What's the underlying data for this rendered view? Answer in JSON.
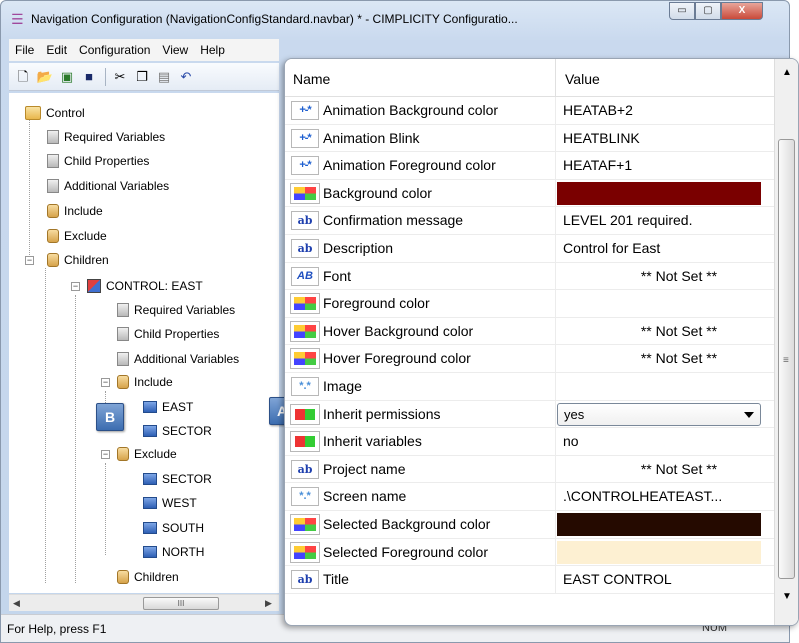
{
  "window": {
    "title": "Navigation Configuration (NavigationConfigStandard.navbar) * - CIMPLICITY Configuratio...",
    "minimize": "▭",
    "maximize": "▢",
    "close": "X"
  },
  "menu": [
    "File",
    "Edit",
    "Configuration",
    "View",
    "Help"
  ],
  "tree": {
    "nodes": [
      {
        "label": "Control",
        "icon": "folder-icon"
      },
      {
        "label": "Required Variables",
        "icon": "property-icon"
      },
      {
        "label": "Child Properties",
        "icon": "property-icon"
      },
      {
        "label": "Additional Variables",
        "icon": "property-icon"
      },
      {
        "label": "Include",
        "icon": "jar-icon"
      },
      {
        "label": "Exclude",
        "icon": "jar-icon"
      },
      {
        "label": "Children",
        "icon": "jar-icon"
      },
      {
        "label": "CONTROL: EAST",
        "icon": "control-icon"
      },
      {
        "label": "Required Variables",
        "icon": "property-icon"
      },
      {
        "label": "Child Properties",
        "icon": "property-icon"
      },
      {
        "label": "Additional Variables",
        "icon": "property-icon"
      },
      {
        "label": "Include",
        "icon": "jar-icon"
      },
      {
        "label": "EAST",
        "icon": "node-icon"
      },
      {
        "label": "SECTOR",
        "icon": "node-icon"
      },
      {
        "label": "Exclude",
        "icon": "jar-icon"
      },
      {
        "label": "SECTOR",
        "icon": "node-icon"
      },
      {
        "label": "WEST",
        "icon": "node-icon"
      },
      {
        "label": "SOUTH",
        "icon": "node-icon"
      },
      {
        "label": "NORTH",
        "icon": "node-icon"
      },
      {
        "label": "Children",
        "icon": "jar-icon"
      }
    ],
    "hscroll_grip": "III"
  },
  "markers": {
    "a": "A",
    "b": "B"
  },
  "grid": {
    "header_name": "Name",
    "header_value": "Value",
    "rows": [
      {
        "name": "Animation Background color",
        "value": "HEATAB+2",
        "icon": "+-*"
      },
      {
        "name": "Animation Blink",
        "value": "HEATBLINK",
        "icon": "+-*"
      },
      {
        "name": "Animation Foreground color",
        "value": "HEATAF+1",
        "icon": "+-*"
      },
      {
        "name": "Background color",
        "value": "",
        "icon": "color",
        "swatch": "#7a0000"
      },
      {
        "name": "Confirmation message",
        "value": "LEVEL 201 required.",
        "icon": "ab"
      },
      {
        "name": "Description",
        "value": "Control for East",
        "icon": "ab"
      },
      {
        "name": "Font",
        "value": "** Not Set **",
        "icon": "AB"
      },
      {
        "name": "Foreground color",
        "value": "",
        "icon": "color"
      },
      {
        "name": "Hover Background color",
        "value": "** Not Set **",
        "icon": "color"
      },
      {
        "name": "Hover Foreground color",
        "value": "** Not Set **",
        "icon": "color"
      },
      {
        "name": "Image",
        "value": "",
        "icon": "*.*"
      },
      {
        "name": "Inherit permissions",
        "value": "yes",
        "icon": "perm"
      },
      {
        "name": "Inherit variables",
        "value": "no",
        "icon": "perm"
      },
      {
        "name": "Project name",
        "value": "** Not Set **",
        "icon": "ab"
      },
      {
        "name": "Screen name",
        "value": ".\\CONTROLHEATEAST...",
        "icon": "*.*"
      },
      {
        "name": "Selected Background color",
        "value": "",
        "icon": "color",
        "swatch": "#250a00"
      },
      {
        "name": "Selected Foreground color",
        "value": "",
        "icon": "color",
        "swatch": "#fdf0d2"
      },
      {
        "name": "Title",
        "value": "EAST CONTROL",
        "icon": "ab"
      }
    ]
  },
  "status": {
    "help": "For Help, press F1",
    "num": "NUM"
  }
}
